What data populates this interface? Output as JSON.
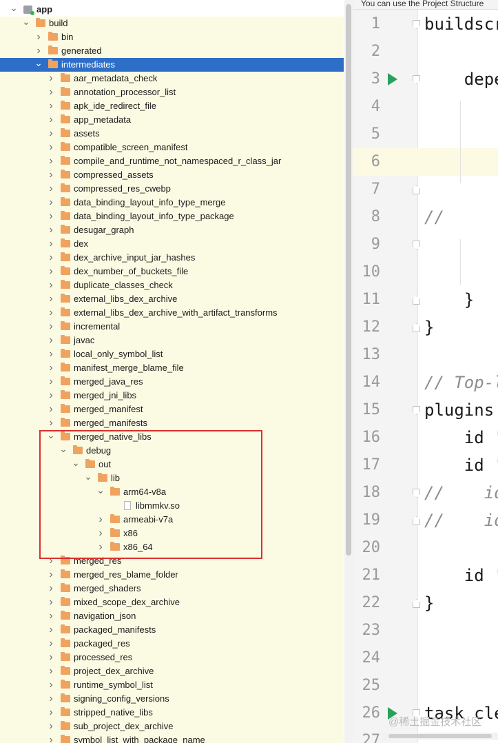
{
  "tree": {
    "rows": [
      {
        "label": "app",
        "depth": 0,
        "expanded": true,
        "icon": "module"
      },
      {
        "label": "build",
        "depth": 1,
        "expanded": true,
        "icon": "folder"
      },
      {
        "label": "bin",
        "depth": 2,
        "expanded": false,
        "icon": "folder"
      },
      {
        "label": "generated",
        "depth": 2,
        "expanded": false,
        "icon": "folder"
      },
      {
        "label": "intermediates",
        "depth": 2,
        "expanded": true,
        "icon": "folder",
        "selected": true
      },
      {
        "label": "aar_metadata_check",
        "depth": 3,
        "expanded": false,
        "icon": "folder"
      },
      {
        "label": "annotation_processor_list",
        "depth": 3,
        "expanded": false,
        "icon": "folder"
      },
      {
        "label": "apk_ide_redirect_file",
        "depth": 3,
        "expanded": false,
        "icon": "folder"
      },
      {
        "label": "app_metadata",
        "depth": 3,
        "expanded": false,
        "icon": "folder"
      },
      {
        "label": "assets",
        "depth": 3,
        "expanded": false,
        "icon": "folder"
      },
      {
        "label": "compatible_screen_manifest",
        "depth": 3,
        "expanded": false,
        "icon": "folder"
      },
      {
        "label": "compile_and_runtime_not_namespaced_r_class_jar",
        "depth": 3,
        "expanded": false,
        "icon": "folder"
      },
      {
        "label": "compressed_assets",
        "depth": 3,
        "expanded": false,
        "icon": "folder"
      },
      {
        "label": "compressed_res_cwebp",
        "depth": 3,
        "expanded": false,
        "icon": "folder"
      },
      {
        "label": "data_binding_layout_info_type_merge",
        "depth": 3,
        "expanded": false,
        "icon": "folder"
      },
      {
        "label": "data_binding_layout_info_type_package",
        "depth": 3,
        "expanded": false,
        "icon": "folder"
      },
      {
        "label": "desugar_graph",
        "depth": 3,
        "expanded": false,
        "icon": "folder"
      },
      {
        "label": "dex",
        "depth": 3,
        "expanded": false,
        "icon": "folder"
      },
      {
        "label": "dex_archive_input_jar_hashes",
        "depth": 3,
        "expanded": false,
        "icon": "folder"
      },
      {
        "label": "dex_number_of_buckets_file",
        "depth": 3,
        "expanded": false,
        "icon": "folder"
      },
      {
        "label": "duplicate_classes_check",
        "depth": 3,
        "expanded": false,
        "icon": "folder"
      },
      {
        "label": "external_libs_dex_archive",
        "depth": 3,
        "expanded": false,
        "icon": "folder"
      },
      {
        "label": "external_libs_dex_archive_with_artifact_transforms",
        "depth": 3,
        "expanded": false,
        "icon": "folder"
      },
      {
        "label": "incremental",
        "depth": 3,
        "expanded": false,
        "icon": "folder"
      },
      {
        "label": "javac",
        "depth": 3,
        "expanded": false,
        "icon": "folder"
      },
      {
        "label": "local_only_symbol_list",
        "depth": 3,
        "expanded": false,
        "icon": "folder"
      },
      {
        "label": "manifest_merge_blame_file",
        "depth": 3,
        "expanded": false,
        "icon": "folder"
      },
      {
        "label": "merged_java_res",
        "depth": 3,
        "expanded": false,
        "icon": "folder"
      },
      {
        "label": "merged_jni_libs",
        "depth": 3,
        "expanded": false,
        "icon": "folder"
      },
      {
        "label": "merged_manifest",
        "depth": 3,
        "expanded": false,
        "icon": "folder"
      },
      {
        "label": "merged_manifests",
        "depth": 3,
        "expanded": false,
        "icon": "folder"
      },
      {
        "label": "merged_native_libs",
        "depth": 3,
        "expanded": true,
        "icon": "folder"
      },
      {
        "label": "debug",
        "depth": 4,
        "expanded": true,
        "icon": "folder"
      },
      {
        "label": "out",
        "depth": 5,
        "expanded": true,
        "icon": "folder"
      },
      {
        "label": "lib",
        "depth": 6,
        "expanded": true,
        "icon": "folder"
      },
      {
        "label": "arm64-v8a",
        "depth": 7,
        "expanded": true,
        "icon": "folder"
      },
      {
        "label": "libmmkv.so",
        "depth": 8,
        "icon": "file"
      },
      {
        "label": "armeabi-v7a",
        "depth": 7,
        "expanded": false,
        "icon": "folder"
      },
      {
        "label": "x86",
        "depth": 7,
        "expanded": false,
        "icon": "folder"
      },
      {
        "label": "x86_64",
        "depth": 7,
        "expanded": false,
        "icon": "folder"
      },
      {
        "label": "merged_res",
        "depth": 3,
        "expanded": false,
        "icon": "folder"
      },
      {
        "label": "merged_res_blame_folder",
        "depth": 3,
        "expanded": false,
        "icon": "folder"
      },
      {
        "label": "merged_shaders",
        "depth": 3,
        "expanded": false,
        "icon": "folder"
      },
      {
        "label": "mixed_scope_dex_archive",
        "depth": 3,
        "expanded": false,
        "icon": "folder"
      },
      {
        "label": "navigation_json",
        "depth": 3,
        "expanded": false,
        "icon": "folder"
      },
      {
        "label": "packaged_manifests",
        "depth": 3,
        "expanded": false,
        "icon": "folder"
      },
      {
        "label": "packaged_res",
        "depth": 3,
        "expanded": false,
        "icon": "folder"
      },
      {
        "label": "processed_res",
        "depth": 3,
        "expanded": false,
        "icon": "folder"
      },
      {
        "label": "project_dex_archive",
        "depth": 3,
        "expanded": false,
        "icon": "folder"
      },
      {
        "label": "runtime_symbol_list",
        "depth": 3,
        "expanded": false,
        "icon": "folder"
      },
      {
        "label": "signing_config_versions",
        "depth": 3,
        "expanded": false,
        "icon": "folder"
      },
      {
        "label": "stripped_native_libs",
        "depth": 3,
        "expanded": false,
        "icon": "folder"
      },
      {
        "label": "sub_project_dex_archive",
        "depth": 3,
        "expanded": false,
        "icon": "folder"
      },
      {
        "label": "symbol_list_with_package_name",
        "depth": 3,
        "expanded": false,
        "icon": "folder"
      }
    ]
  },
  "editor": {
    "notice": "You can use the Project Structure",
    "lines": [
      {
        "n": "1",
        "text": "buildscr",
        "fold": "up"
      },
      {
        "n": "2",
        "text": ""
      },
      {
        "n": "3",
        "text": "    depe",
        "fold": "up",
        "run": true
      },
      {
        "n": "4",
        "text": ""
      },
      {
        "n": "5",
        "text": ""
      },
      {
        "n": "6",
        "text": "",
        "current": true
      },
      {
        "n": "7",
        "text": "",
        "fold": "down"
      },
      {
        "n": "8",
        "text": "//",
        "comment": true
      },
      {
        "n": "9",
        "text": "",
        "fold": "up"
      },
      {
        "n": "10",
        "text": ""
      },
      {
        "n": "11",
        "text": "    }",
        "fold": "down"
      },
      {
        "n": "12",
        "text": "}",
        "fold": "down"
      },
      {
        "n": "13",
        "text": ""
      },
      {
        "n": "14",
        "text": "// Top-l",
        "comment": true
      },
      {
        "n": "15",
        "text": "plugins",
        "fold": "up"
      },
      {
        "n": "16",
        "text": "    id '",
        "strtail": true
      },
      {
        "n": "17",
        "text": "    id '",
        "strtail": true
      },
      {
        "n": "18",
        "text": "//    id",
        "comment": true,
        "fold": "up"
      },
      {
        "n": "19",
        "text": "//    id",
        "comment": true,
        "fold": "down"
      },
      {
        "n": "20",
        "text": ""
      },
      {
        "n": "21",
        "text": "    id '",
        "strtail": true
      },
      {
        "n": "22",
        "text": "}",
        "fold": "down"
      },
      {
        "n": "23",
        "text": ""
      },
      {
        "n": "24",
        "text": ""
      },
      {
        "n": "25",
        "text": ""
      },
      {
        "n": "26",
        "text": "task cle",
        "fold": "up",
        "run": true
      },
      {
        "n": "27",
        "text": ""
      }
    ],
    "watermark": "@稀土掘金技术社区"
  }
}
